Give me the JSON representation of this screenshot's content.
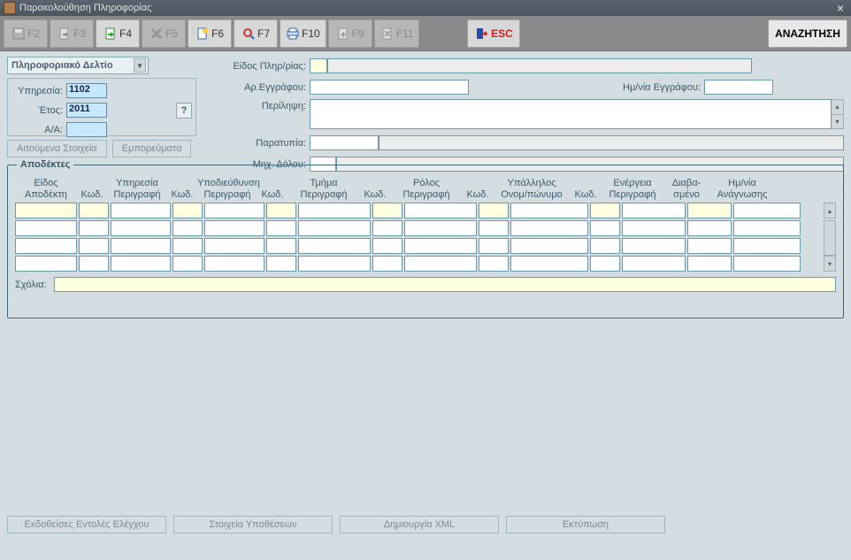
{
  "window": {
    "title": "Παρακολούθηση Πληροφορίας"
  },
  "toolbar": {
    "f2": "F2",
    "f3": "F3",
    "f4": "F4",
    "f5": "F5",
    "f6": "F6",
    "f7": "F7",
    "f10": "F10",
    "f9": "F9",
    "f11": "F11",
    "esc": "ESC",
    "search": "ΑΝΑΖΗΤΗΣΗ"
  },
  "dropdown": {
    "selected": "Πληροφοριακό Δελτίο"
  },
  "ident": {
    "service_label": "Υπηρεσία:",
    "service_value": "1102",
    "year_label": "Έτος:",
    "year_value": "2011",
    "aa_label": "Α/Α:",
    "aa_value": "",
    "help": "?"
  },
  "form": {
    "type_label": "Είδος Πληρ/ρίας:",
    "docno_label": "Αρ.Εγγράφου:",
    "docdate_label": "Ημ/νία Εγγράφου:",
    "summary_label": "Περίληψη:",
    "irregularity_label": "Παρατυπία:",
    "fraud_label": "Μηχ. Δόλου:"
  },
  "subtabs": {
    "requested": "Αιτούμενα Στοιχεία",
    "goods": "Εμπορεύματα"
  },
  "recipients": {
    "legend": "Αποδέκτες",
    "headers": {
      "type": "Είδος\nΑποδέκτη",
      "serv_code": "Κωδ.",
      "serv_desc": "Υπηρεσία\nΠεριγραφή",
      "sub_code": "Κωδ.",
      "sub_desc": "Υποδιεύθυνση\nΠεριγραφή",
      "dept_code": "Κωδ.",
      "dept_desc": "Τμήμα\nΠεριγραφή",
      "role_code": "Κωδ.",
      "role_desc": "Ρόλος\nΠεριγραφή",
      "emp_code": "Κωδ.",
      "emp_name": "Υπάλληλος\nΟνομ/πώνυμο",
      "act_code": "Κωδ.",
      "act_desc": "Ενέργεια\nΠεριγραφή",
      "read": "Διαβα-\nσμένο",
      "readdate": "Ημ/νία\nΑνάγνωσης"
    },
    "comments_label": "Σχόλια:"
  },
  "footer": {
    "orders": "Εκδοθείσες Εντολές Ελέγχου",
    "cases": "Στοιχεία Υποθέσεων",
    "xml": "Δημιουργία XML",
    "print": "Εκτύπωση"
  }
}
